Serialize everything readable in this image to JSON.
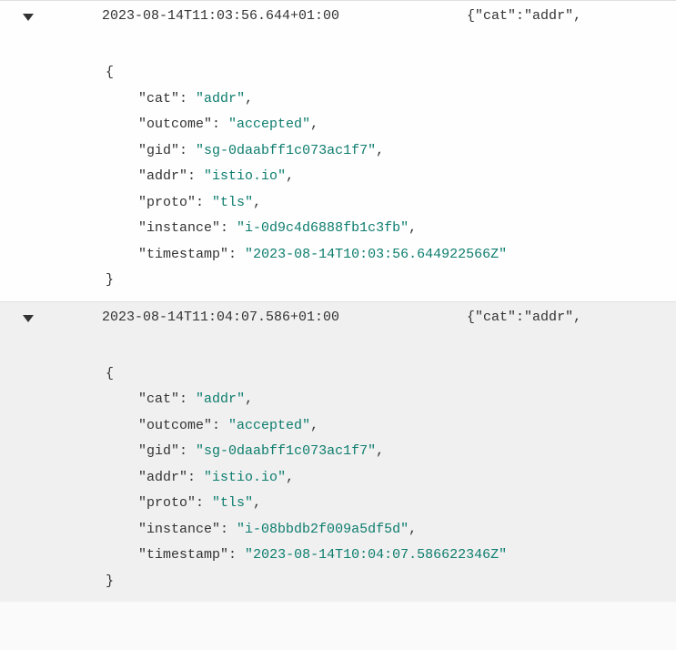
{
  "entries": [
    {
      "display_timestamp": "2023-08-14T11:03:56.644+01:00",
      "preview": "{\"cat\":\"addr\",",
      "json": {
        "cat": "addr",
        "outcome": "accepted",
        "gid": "sg-0daabff1c073ac1f7",
        "addr": "istio.io",
        "proto": "tls",
        "instance": "i-0d9c4d6888fb1c3fb",
        "timestamp": "2023-08-14T10:03:56.644922566Z"
      }
    },
    {
      "display_timestamp": "2023-08-14T11:04:07.586+01:00",
      "preview": "{\"cat\":\"addr\",",
      "json": {
        "cat": "addr",
        "outcome": "accepted",
        "gid": "sg-0daabff1c073ac1f7",
        "addr": "istio.io",
        "proto": "tls",
        "instance": "i-08bbdb2f009a5df5d",
        "timestamp": "2023-08-14T10:04:07.586622346Z"
      }
    }
  ]
}
